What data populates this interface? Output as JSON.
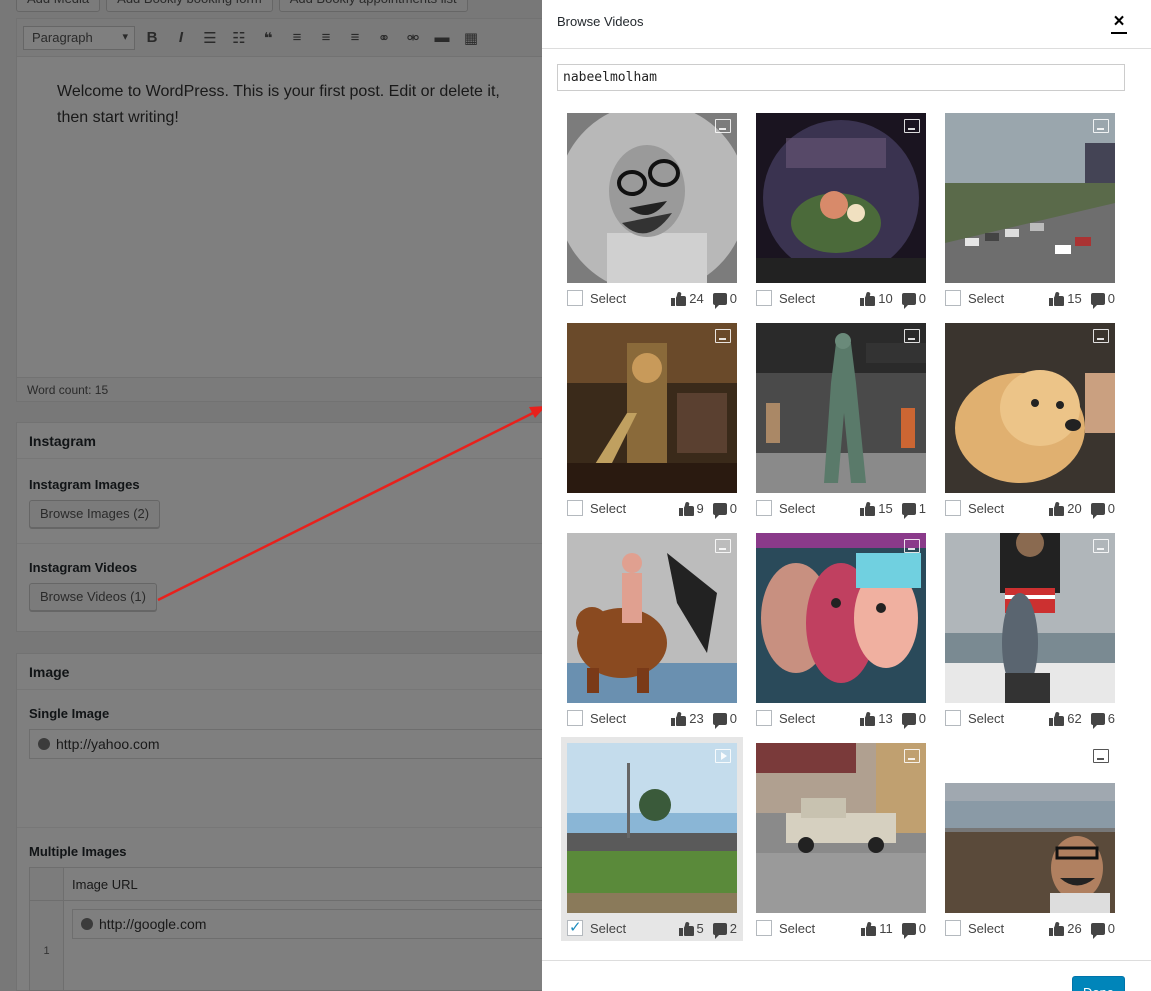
{
  "editor": {
    "media_buttons": [
      "Add Media",
      "Add Bookly booking form",
      "Add Bookly appointments list"
    ],
    "format_select": "Paragraph",
    "content": "Welcome to WordPress. This is your first post. Edit or delete it, then start writing!",
    "word_count": "Word count: 15"
  },
  "instagram_box": {
    "title": "Instagram",
    "images_label": "Instagram Images",
    "images_button": "Browse Images (2)",
    "videos_label": "Instagram Videos",
    "videos_button": "Browse Videos (1)"
  },
  "image_box": {
    "title": "Image",
    "single_label": "Single Image",
    "single_value": "http://yahoo.com",
    "multiple_label": "Multiple Images",
    "column_header": "Image URL",
    "rows": [
      {
        "num": "1",
        "value": "http://google.com"
      }
    ]
  },
  "modal": {
    "title": "Browse Videos",
    "close_label": "×",
    "search_value": "nabeelmolham",
    "done_label": "Done",
    "items": [
      {
        "select_label": "Select",
        "likes": "24",
        "comments": "0",
        "checked": false,
        "type": "image",
        "theme": "portrait-bw"
      },
      {
        "select_label": "Select",
        "likes": "10",
        "comments": "0",
        "checked": false,
        "type": "image",
        "theme": "terrarium"
      },
      {
        "select_label": "Select",
        "likes": "15",
        "comments": "0",
        "checked": false,
        "type": "image",
        "theme": "carpark"
      },
      {
        "select_label": "Select",
        "likes": "9",
        "comments": "0",
        "checked": false,
        "type": "image",
        "theme": "interior"
      },
      {
        "select_label": "Select",
        "likes": "15",
        "comments": "1",
        "checked": false,
        "type": "image",
        "theme": "statue"
      },
      {
        "select_label": "Select",
        "likes": "20",
        "comments": "0",
        "checked": false,
        "type": "image",
        "theme": "dog"
      },
      {
        "select_label": "Select",
        "likes": "23",
        "comments": "0",
        "checked": false,
        "type": "image",
        "theme": "bear-mural"
      },
      {
        "select_label": "Select",
        "likes": "13",
        "comments": "0",
        "checked": false,
        "type": "image",
        "theme": "faces-mural"
      },
      {
        "select_label": "Select",
        "likes": "62",
        "comments": "6",
        "checked": false,
        "type": "image",
        "theme": "fish"
      },
      {
        "select_label": "Select",
        "likes": "5",
        "comments": "2",
        "checked": true,
        "type": "video",
        "theme": "field"
      },
      {
        "select_label": "Select",
        "likes": "11",
        "comments": "0",
        "checked": false,
        "type": "image",
        "theme": "truck"
      },
      {
        "select_label": "Select",
        "likes": "26",
        "comments": "0",
        "checked": false,
        "type": "image",
        "theme": "pier-selfie"
      }
    ]
  },
  "colors": {
    "primary_button": "#0085ba",
    "checkbox_check": "#1e8cbe",
    "arrow": "#e8211c"
  }
}
